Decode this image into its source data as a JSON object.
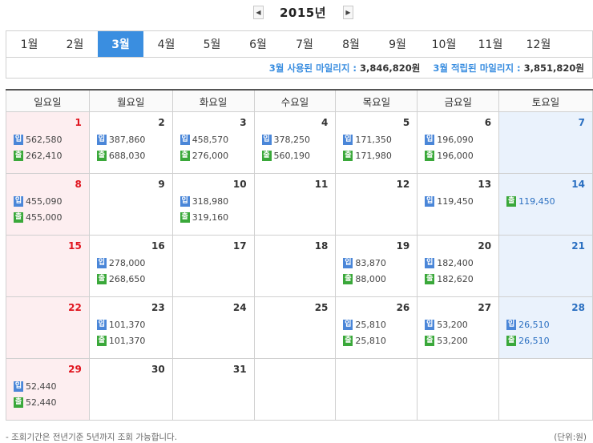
{
  "year_nav": {
    "year": "2015년",
    "prev_icon": "◀",
    "next_icon": "▶"
  },
  "months": [
    "1월",
    "2월",
    "3월",
    "4월",
    "5월",
    "6월",
    "7월",
    "8월",
    "9월",
    "10월",
    "11월",
    "12월"
  ],
  "active_month_index": 2,
  "summary": {
    "used_label": "3월 사용된 마일리지 :",
    "used_value": "3,846,820원",
    "earned_label": "3월 적립된 마일리지 :",
    "earned_value": "3,851,820원"
  },
  "weekdays": [
    "일요일",
    "월요일",
    "화요일",
    "수요일",
    "목요일",
    "금요일",
    "토요일"
  ],
  "entry_labels": {
    "in": "입",
    "out": "출"
  },
  "weeks": [
    [
      {
        "day": "1",
        "in": "562,580",
        "out": "262,410"
      },
      {
        "day": "2",
        "in": "387,860",
        "out": "688,030"
      },
      {
        "day": "3",
        "in": "458,570",
        "out": "276,000"
      },
      {
        "day": "4",
        "in": "378,250",
        "out": "560,190"
      },
      {
        "day": "5",
        "in": "171,350",
        "out": "171,980"
      },
      {
        "day": "6",
        "in": "196,090",
        "out": "196,000"
      },
      {
        "day": "7"
      }
    ],
    [
      {
        "day": "8",
        "in": "455,090",
        "out": "455,000"
      },
      {
        "day": "9"
      },
      {
        "day": "10",
        "in": "318,980",
        "out": "319,160"
      },
      {
        "day": "11"
      },
      {
        "day": "12"
      },
      {
        "day": "13",
        "in": "119,450"
      },
      {
        "day": "14",
        "out": "119,450"
      }
    ],
    [
      {
        "day": "15"
      },
      {
        "day": "16",
        "in": "278,000",
        "out": "268,650"
      },
      {
        "day": "17"
      },
      {
        "day": "18"
      },
      {
        "day": "19",
        "in": "83,870",
        "out": "88,000"
      },
      {
        "day": "20",
        "in": "182,400",
        "out": "182,620"
      },
      {
        "day": "21"
      }
    ],
    [
      {
        "day": "22"
      },
      {
        "day": "23",
        "in": "101,370",
        "out": "101,370"
      },
      {
        "day": "24"
      },
      {
        "day": "25"
      },
      {
        "day": "26",
        "in": "25,810",
        "out": "25,810"
      },
      {
        "day": "27",
        "in": "53,200",
        "out": "53,200"
      },
      {
        "day": "28",
        "in": "26,510",
        "out": "26,510"
      }
    ],
    [
      {
        "day": "29",
        "in": "52,440",
        "out": "52,440"
      },
      {
        "day": "30"
      },
      {
        "day": "31"
      },
      {},
      {},
      {},
      {}
    ]
  ],
  "footnote": "- 조회기간은 전년기준 5년까지 조회 가능합니다.",
  "unit": "(단위:원)",
  "colors": {
    "accent": "#3a8ee0",
    "sunday": "#e0141e",
    "saturday": "#2a6fc1",
    "in_tag": "#4a86d8",
    "out_tag": "#3aa83a"
  }
}
